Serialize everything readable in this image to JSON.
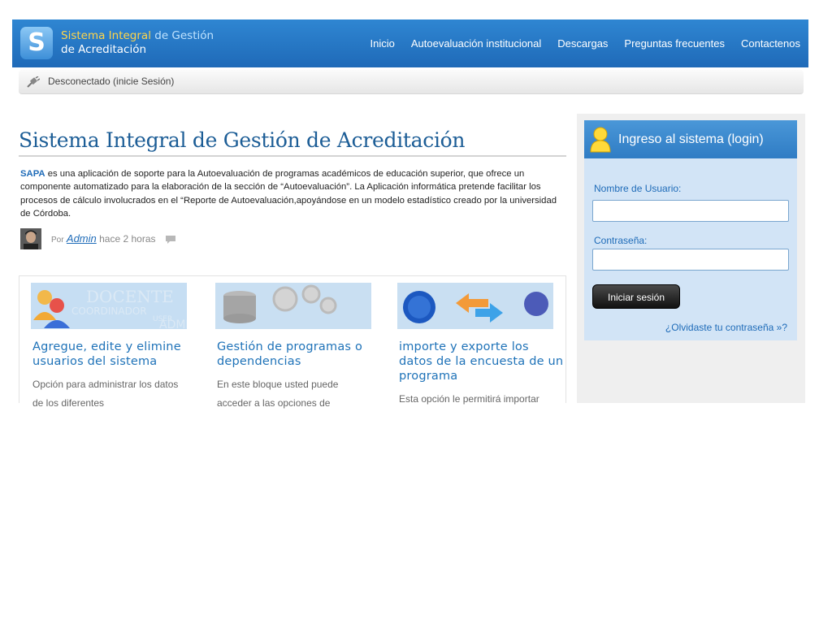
{
  "header": {
    "logo_letter": "S",
    "logo_line1_part1": "Sistema Integral",
    "logo_line1_part2": " de Gestión",
    "logo_line2": "de Acreditación",
    "nav": [
      "Inicio",
      "Autoevaluación institucional",
      "Descargas",
      "Preguntas frecuentes",
      "Contactenos"
    ]
  },
  "status": {
    "text": "Desconectado (inicie Sesión)"
  },
  "article": {
    "title": "Sistema Integral de Gestión de Acreditación",
    "intro_strong": "SAPA",
    "intro_text": " es una aplicación de soporte para la Autoevaluación de programas académicos de educación superior, que ofrece un componente automatizado para la elaboración de la sección de “Autoevaluación”. La Aplicación informática pretende facilitar los procesos de cálculo involucrados en el “Reporte de Autoevaluación,apoyándose en un modelo estadístico creado por la universidad de Córdoba.",
    "meta_por": "Por",
    "meta_author": "Admin",
    "meta_time": "hace 2 horas"
  },
  "features": [
    {
      "title": "Agregue, edite y elimine usuarios del sistema",
      "text": "Opción para administrar los datos de los diferentes",
      "image_words": [
        "DOCENTE",
        "COORDINADOR",
        "USER",
        "ADMIN"
      ]
    },
    {
      "title": "Gestión de programas o dependencias",
      "text": "En este bloque usted puede acceder a las opciones de"
    },
    {
      "title": "importe y exporte los datos de la encuesta de un programa",
      "text": "Esta opción le permitirá importar"
    }
  ],
  "login": {
    "title": "Ingreso al sistema (login)",
    "username_label": "Nombre de Usuario:",
    "username_value": "",
    "password_label": "Contraseña:",
    "password_value": "",
    "submit_label": "Iniciar sesión",
    "forgot_label": "¿Olvidaste tu contraseña »?"
  },
  "colors": {
    "header_blue": "#2a7bc8",
    "title_blue": "#1c5d96",
    "link_blue": "#1e6bb8",
    "login_panel_bg": "#d2e4f6",
    "sidebar_bg": "#efefef"
  }
}
